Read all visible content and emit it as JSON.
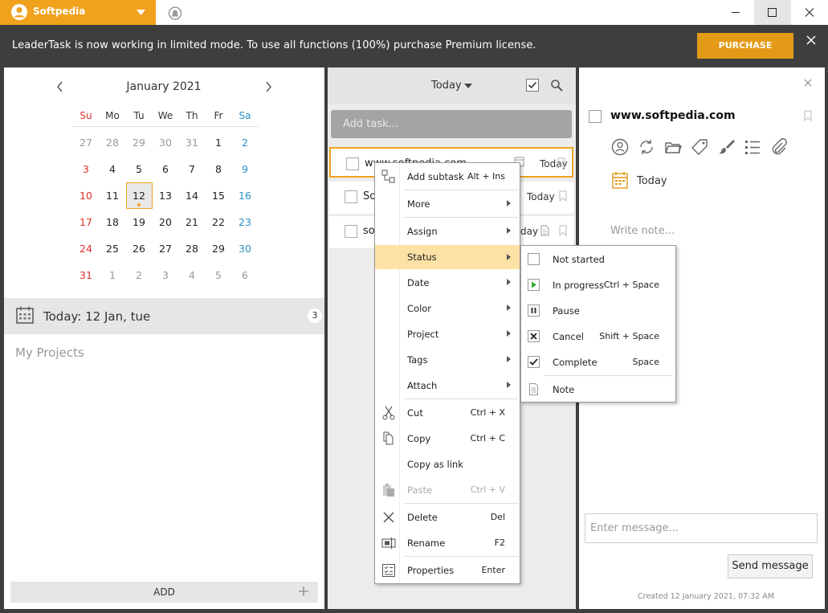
{
  "user": {
    "name": "Softpedia"
  },
  "banner": {
    "text": "LeaderTask is now working in limited mode. To use all functions (100%) purchase Premium license.",
    "purchase": "PURCHASE"
  },
  "calendar": {
    "month": "January 2021",
    "weekdays": [
      "Su",
      "Mo",
      "Tu",
      "We",
      "Th",
      "Fr",
      "Sa"
    ],
    "weeks": [
      [
        "27",
        "28",
        "29",
        "30",
        "31",
        "1",
        "2"
      ],
      [
        "3",
        "4",
        "5",
        "6",
        "7",
        "8",
        "9"
      ],
      [
        "10",
        "11",
        "12",
        "13",
        "14",
        "15",
        "16"
      ],
      [
        "17",
        "18",
        "19",
        "20",
        "21",
        "22",
        "23"
      ],
      [
        "24",
        "25",
        "26",
        "27",
        "28",
        "29",
        "30"
      ],
      [
        "31",
        "1",
        "2",
        "3",
        "4",
        "5",
        "6"
      ]
    ]
  },
  "today_bar": {
    "label": "Today: 12 Jan, tue",
    "count": "3"
  },
  "projects": {
    "label": "My Projects"
  },
  "add_button": "ADD",
  "tasklist": {
    "filter": "Today",
    "add_placeholder": "Add task...",
    "tasks": [
      {
        "title": "www.softpedia.com",
        "date": "Today"
      },
      {
        "title": "So",
        "date": "Today"
      },
      {
        "title": "so",
        "date": "day"
      }
    ]
  },
  "detail": {
    "title": "www.softpedia.com",
    "date": "Today",
    "note_placeholder": "Write note...",
    "message_placeholder": "Enter message...",
    "send": "Send message",
    "created": "Created 12 January 2021, 07:32 AM"
  },
  "context_menu": {
    "items": [
      {
        "label": "Add subtask",
        "shortcut": "Alt + Ins"
      },
      {
        "label": "More"
      },
      {
        "label": "Assign"
      },
      {
        "label": "Status"
      },
      {
        "label": "Date"
      },
      {
        "label": "Color"
      },
      {
        "label": "Project"
      },
      {
        "label": "Tags"
      },
      {
        "label": "Attach"
      },
      {
        "label": "Cut",
        "shortcut": "Ctrl + X"
      },
      {
        "label": "Copy",
        "shortcut": "Ctrl + C"
      },
      {
        "label": "Copy as link"
      },
      {
        "label": "Paste",
        "shortcut": "Ctrl + V"
      },
      {
        "label": "Delete",
        "shortcut": "Del"
      },
      {
        "label": "Rename",
        "shortcut": "F2"
      },
      {
        "label": "Properties",
        "shortcut": "Enter"
      }
    ]
  },
  "status_menu": {
    "items": [
      {
        "label": "Not started"
      },
      {
        "label": "In progress",
        "shortcut": "Ctrl + Space"
      },
      {
        "label": "Pause"
      },
      {
        "label": "Cancel",
        "shortcut": "Shift + Space"
      },
      {
        "label": "Complete",
        "shortcut": "Space"
      },
      {
        "label": "Note"
      }
    ]
  },
  "colors": {
    "accent": "#f0a21c",
    "purchase": "#e29a17",
    "sunday": "#e0322a",
    "saturday": "#2a8fc6",
    "highlight": "#fde2a6",
    "banner": "#3e3e3e"
  }
}
